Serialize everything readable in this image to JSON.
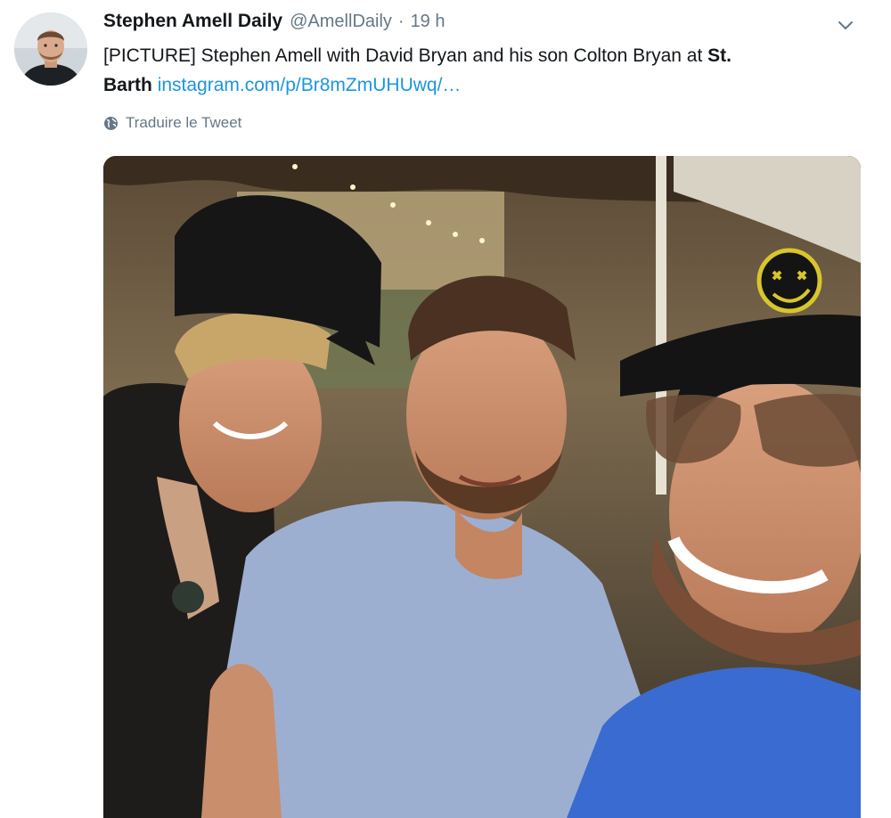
{
  "tweet": {
    "author_name": "Stephen Amell Daily",
    "author_handle": "@AmellDaily",
    "separator": "·",
    "time": "19 h",
    "text_before_bold": "[PICTURE] Stephen Amell with David Bryan and his son Colton Bryan at ",
    "text_bold_1": "St.",
    "text_bold_2": "Barth",
    "link_text": "instagram.com/p/Br8mZmUHUwq/…",
    "translate_label": "Traduire le Tweet",
    "photo_alt": "Stephen Amell with David Bryan and his son Colton Bryan at St. Barth"
  },
  "icons": {
    "more": "chevron-down-icon",
    "translate": "globe-icon"
  },
  "colors": {
    "link": "#1b95e0",
    "secondary_text": "#657786",
    "primary_text": "#14171a"
  }
}
